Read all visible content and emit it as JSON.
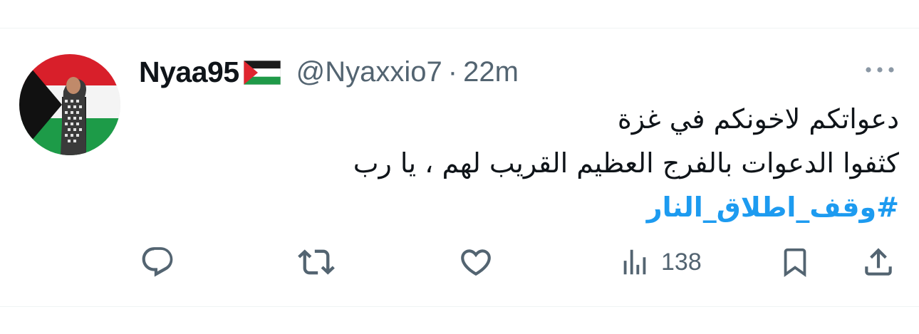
{
  "tweet": {
    "display_name": "Nyaa95",
    "handle": "@Nyaxxio7",
    "separator": "·",
    "time": "22m",
    "lines": [
      "دعواتكم لاخونكم في غزة",
      "كثفوا الدعوات بالفرج العظيم القريب لهم ، يا رب"
    ],
    "hashtag": "#وقف_اطلاق_النار"
  },
  "actions": {
    "reply_icon": "reply-icon",
    "retweet_icon": "retweet-icon",
    "like_icon": "heart-icon",
    "views_icon": "views-chart-icon",
    "views_count": "138",
    "bookmark_icon": "bookmark-icon",
    "share_icon": "share-icon"
  },
  "colors": {
    "text": "#0f1419",
    "muted": "#536471",
    "link": "#1d9bf0",
    "divider": "#eff3f4"
  }
}
